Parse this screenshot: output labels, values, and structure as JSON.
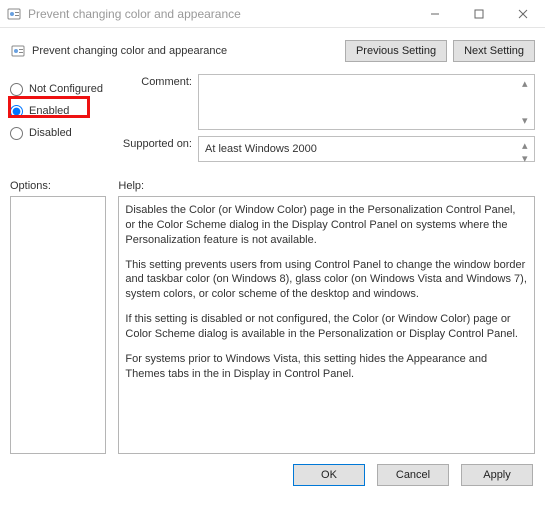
{
  "titlebar": {
    "title": "Prevent changing color and appearance"
  },
  "header": {
    "title": "Prevent changing color and appearance",
    "prev": "Previous Setting",
    "next": "Next Setting"
  },
  "state": {
    "not_configured": "Not Configured",
    "enabled": "Enabled",
    "disabled": "Disabled",
    "selected": "enabled"
  },
  "fields": {
    "comment_label": "Comment:",
    "comment_value": "",
    "supported_label": "Supported on:",
    "supported_value": "At least Windows 2000"
  },
  "panels": {
    "options_label": "Options:",
    "help_label": "Help:"
  },
  "help": {
    "p1": "Disables the Color (or Window Color) page in the Personalization Control Panel, or the Color Scheme dialog in the Display Control Panel on systems where the Personalization feature is not available.",
    "p2": "This setting prevents users from using Control Panel to change the window border and taskbar color (on Windows 8), glass color (on Windows Vista and Windows 7), system colors, or color scheme of the desktop and windows.",
    "p3": "If this setting is disabled or not configured, the Color (or Window Color) page or Color Scheme dialog is available in the Personalization or Display Control Panel.",
    "p4": "For systems prior to Windows Vista, this setting hides the Appearance and Themes tabs in the in Display in Control Panel."
  },
  "footer": {
    "ok": "OK",
    "cancel": "Cancel",
    "apply": "Apply"
  }
}
